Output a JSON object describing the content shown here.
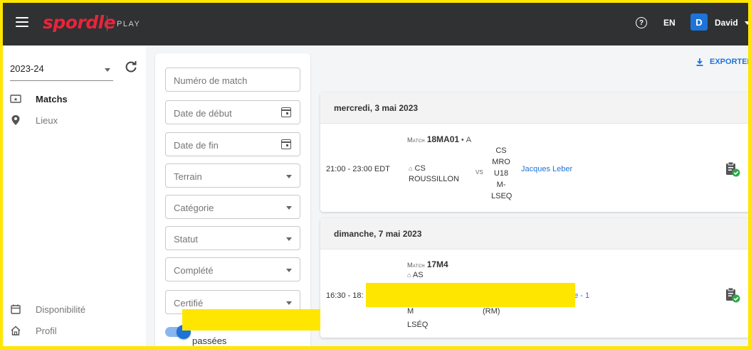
{
  "topbar": {
    "logo": "spordle",
    "product": "PLAY",
    "help_icon": "help-circle-icon",
    "language": "EN",
    "avatar_initial": "D",
    "username": "David"
  },
  "sidebar": {
    "season": "2023-24",
    "items": [
      {
        "label": "Matchs",
        "icon": "ticket-icon",
        "active": true
      },
      {
        "label": "Lieux",
        "icon": "location-pin-icon",
        "active": false
      },
      {
        "label": "Disponibilité",
        "icon": "calendar-icon",
        "active": false
      },
      {
        "label": "Profil",
        "icon": "home-icon",
        "active": false
      }
    ]
  },
  "filters": {
    "match_number": "Numéro de match",
    "start_date": "Date de début",
    "end_date": "Date de fin",
    "venue": "Terrain",
    "category": "Catégorie",
    "status": "Statut",
    "completed": "Complété",
    "certified": "Certifié",
    "toggle_label": "passées",
    "toggle_on": true
  },
  "main": {
    "export_label": "EXPORTER",
    "days": [
      {
        "date": "mercredi, 3 mai 2023",
        "games": [
          {
            "time": "21:00 - 23:00 EDT",
            "match_prefix": "Match",
            "match_id": "18MA01",
            "match_suffix": "• A",
            "home_icon": "home-small-icon",
            "home_team_1": "CS",
            "home_team_2": "ROUSSILLON",
            "vs": "VS",
            "away_team_lines": [
              "CS",
              "MRO",
              "U18",
              "M-",
              "LSEQ"
            ],
            "official": "Jacques Leber",
            "status_icon": "clipboard-check-icon"
          }
        ]
      },
      {
        "date": "dimanche, 7 mai 2023",
        "games": [
          {
            "time": "16:30 - 18:",
            "match_prefix": "Match",
            "match_id": "17M4",
            "home_icon": "home-small-icon",
            "home_team_1": "AS",
            "home_line_3": "M",
            "home_line_4": "LSÉQ",
            "away_line": "(RM)",
            "official_partial": "ne - 1",
            "status_icon": "clipboard-check-icon"
          }
        ]
      }
    ]
  },
  "colors": {
    "topbar_bg": "#2f3133",
    "brand_red": "#e8243b",
    "accent_blue": "#1e73d8",
    "check_green": "#2ea84a",
    "highlight_border": "#ffe600"
  }
}
